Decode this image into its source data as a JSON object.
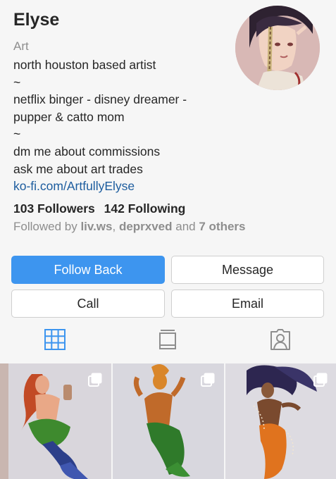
{
  "profile": {
    "name": "Elyse",
    "category": "Art",
    "bio_lines": [
      "north houston based artist",
      "~",
      "netflix binger - disney dreamer -",
      "pupper & catto mom",
      "~",
      "dm me about commissions",
      "ask me about art trades"
    ],
    "link": "ko-fi.com/ArtfullyElyse",
    "followers": "103 Followers",
    "following": "142 Following",
    "followed_by": {
      "prefix": "Followed by ",
      "user1": "liv.ws",
      "separator": ", ",
      "user2": "deprxved",
      "middle": " and ",
      "others": "7 others"
    }
  },
  "buttons": {
    "follow_back": "Follow Back",
    "message": "Message",
    "call": "Call",
    "email": "Email"
  },
  "tabs": [
    {
      "icon": "grid-icon",
      "active": true
    },
    {
      "icon": "igtv-icon",
      "active": false
    },
    {
      "icon": "tagged-icon",
      "active": false
    }
  ],
  "posts": [
    {
      "icon": "multiple-photos-icon",
      "description": "mermaid with red hair and green skirt"
    },
    {
      "icon": "multiple-photos-icon",
      "description": "orange mermaid with green tail"
    },
    {
      "icon": "multiple-photos-icon",
      "description": "mermaid with dark hair and orange tail"
    }
  ],
  "colors": {
    "accent": "#3d95ef",
    "link": "#1c5c9e",
    "muted": "#8e8e8e",
    "text": "#262626"
  }
}
